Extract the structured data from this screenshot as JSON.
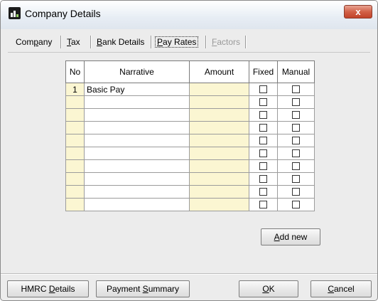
{
  "window": {
    "title": "Company Details",
    "close_label": "x"
  },
  "tabs": [
    {
      "pre": "Com",
      "key": "p",
      "post": "any",
      "state": "normal"
    },
    {
      "pre": "",
      "key": "T",
      "post": "ax",
      "state": "normal"
    },
    {
      "pre": "",
      "key": "B",
      "post": "ank Details",
      "state": "normal"
    },
    {
      "pre": "",
      "key": "P",
      "post": "ay Rates",
      "state": "active"
    },
    {
      "pre": "",
      "key": "F",
      "post": "actors",
      "state": "disabled"
    }
  ],
  "grid": {
    "headers": {
      "no": "No",
      "narrative": "Narrative",
      "amount": "Amount",
      "fixed": "Fixed",
      "manual": "Manual"
    },
    "rows": [
      {
        "no": "1",
        "narrative": "Basic Pay",
        "amount": "",
        "fixed": false,
        "manual": false
      },
      {
        "no": "",
        "narrative": "",
        "amount": "",
        "fixed": false,
        "manual": false
      },
      {
        "no": "",
        "narrative": "",
        "amount": "",
        "fixed": false,
        "manual": false
      },
      {
        "no": "",
        "narrative": "",
        "amount": "",
        "fixed": false,
        "manual": false
      },
      {
        "no": "",
        "narrative": "",
        "amount": "",
        "fixed": false,
        "manual": false
      },
      {
        "no": "",
        "narrative": "",
        "amount": "",
        "fixed": false,
        "manual": false
      },
      {
        "no": "",
        "narrative": "",
        "amount": "",
        "fixed": false,
        "manual": false
      },
      {
        "no": "",
        "narrative": "",
        "amount": "",
        "fixed": false,
        "manual": false
      },
      {
        "no": "",
        "narrative": "",
        "amount": "",
        "fixed": false,
        "manual": false
      },
      {
        "no": "",
        "narrative": "",
        "amount": "",
        "fixed": false,
        "manual": false
      }
    ]
  },
  "buttons": {
    "add_new": {
      "pre": "",
      "key": "A",
      "post": "dd new"
    },
    "hmrc": {
      "pre": "HMRC ",
      "key": "D",
      "post": "etails"
    },
    "payment_summary": {
      "pre": "Payment ",
      "key": "S",
      "post": "ummary"
    },
    "ok": {
      "pre": "",
      "key": "O",
      "post": "K"
    },
    "cancel": {
      "pre": "",
      "key": "C",
      "post": "ancel"
    }
  },
  "colors": {
    "accent_cell": "#fbf6d2",
    "close_button": "#c2432a"
  }
}
